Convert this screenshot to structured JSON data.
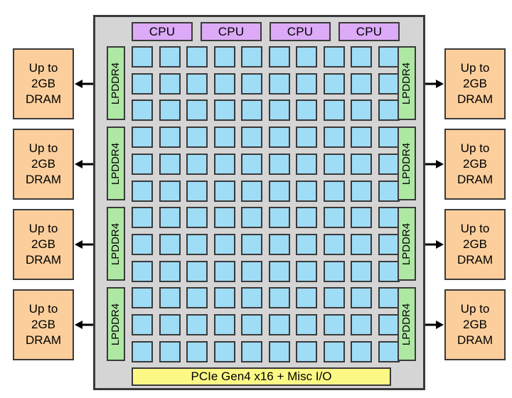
{
  "diagram": {
    "title": "SoC block diagram with CPU cluster, accelerator tile array, LPDDR4 memory controllers and external DRAM",
    "colors": {
      "package_fill": "#d5d5d5",
      "package_stroke": "#3a3a3a",
      "cpu_fill": "#dcaaf7",
      "tile_fill": "#9fdcf5",
      "lpddr_fill": "#aee8a3",
      "pcie_fill": "#fbf885",
      "dram_fill": "#fbce9c",
      "background": "#ffffff"
    },
    "package": {
      "name": "soc-die"
    },
    "cpu_blocks": [
      {
        "label": "CPU"
      },
      {
        "label": "CPU"
      },
      {
        "label": "CPU"
      },
      {
        "label": "CPU"
      }
    ],
    "tile_array": {
      "rows": 12,
      "columns": 10,
      "total_tiles": 120,
      "tile_label": ""
    },
    "lpddr_left": [
      {
        "label": "LPDDR4"
      },
      {
        "label": "LPDDR4"
      },
      {
        "label": "LPDDR4"
      },
      {
        "label": "LPDDR4"
      }
    ],
    "lpddr_right": [
      {
        "label": "LPDDR4"
      },
      {
        "label": "LPDDR4"
      },
      {
        "label": "LPDDR4"
      },
      {
        "label": "LPDDR4"
      }
    ],
    "pcie_bar": {
      "label": "PCIe Gen4 x16 + Misc I/O"
    },
    "dram_left": [
      {
        "line1": "Up to",
        "line2": "2GB",
        "line3": "DRAM"
      },
      {
        "line1": "Up to",
        "line2": "2GB",
        "line3": "DRAM"
      },
      {
        "line1": "Up to",
        "line2": "2GB",
        "line3": "DRAM"
      },
      {
        "line1": "Up to",
        "line2": "2GB",
        "line3": "DRAM"
      }
    ],
    "dram_right": [
      {
        "line1": "Up to",
        "line2": "2GB",
        "line3": "DRAM"
      },
      {
        "line1": "Up to",
        "line2": "2GB",
        "line3": "DRAM"
      },
      {
        "line1": "Up to",
        "line2": "2GB",
        "line3": "DRAM"
      },
      {
        "line1": "Up to",
        "line2": "2GB",
        "line3": "DRAM"
      }
    ],
    "connectors": {
      "kind": "double-headed-arrow",
      "count": 8
    }
  }
}
